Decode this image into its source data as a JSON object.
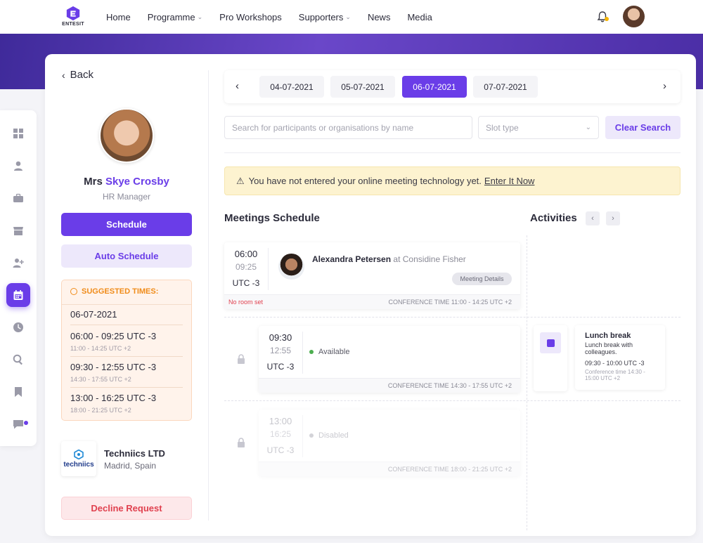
{
  "brand": {
    "logo_text": "ENTESIT",
    "accent": "#6a3de8"
  },
  "nav": {
    "items": [
      {
        "label": "Home",
        "dropdown": false
      },
      {
        "label": "Programme",
        "dropdown": true
      },
      {
        "label": "Pro Workshops",
        "dropdown": false
      },
      {
        "label": "Supporters",
        "dropdown": true
      },
      {
        "label": "News",
        "dropdown": false
      },
      {
        "label": "Media",
        "dropdown": false
      }
    ]
  },
  "sidebar_icons": [
    "grid-icon",
    "user-icon",
    "briefcase-icon",
    "store-icon",
    "add-user-icon",
    "calendar-icon",
    "clock-icon",
    "search-icon",
    "bookmark-icon",
    "chat-icon"
  ],
  "profile": {
    "back_label": "Back",
    "salutation": "Mrs",
    "name": "Skye Crosby",
    "role": "HR Manager",
    "schedule_label": "Schedule",
    "auto_schedule_label": "Auto Schedule",
    "suggested": {
      "heading": "SUGGESTED TIMES:",
      "date": "06-07-2021",
      "slots": [
        {
          "time": "06:00 - 09:25 UTC -3",
          "conf": "11:00 - 14:25 UTC +2"
        },
        {
          "time": "09:30 - 12:55 UTC -3",
          "conf": "14:30 - 17:55 UTC +2"
        },
        {
          "time": "13:00 - 16:25 UTC -3",
          "conf": "18:00 - 21:25 UTC +2"
        }
      ]
    },
    "organisation": {
      "logo_text": "techniics",
      "name": "Techniics LTD",
      "location": "Madrid, Spain"
    },
    "decline_label": "Decline Request"
  },
  "dates": {
    "items": [
      "04-07-2021",
      "05-07-2021",
      "06-07-2021",
      "07-07-2021"
    ],
    "active": "06-07-2021"
  },
  "search": {
    "placeholder": "Search for participants or organisations by name",
    "slot_type_placeholder": "Slot type",
    "clear_label": "Clear Search"
  },
  "warning": {
    "text": "You have not entered your online meeting technology yet.",
    "link": "Enter It Now"
  },
  "meetings": {
    "heading": "Meetings Schedule",
    "slots": [
      {
        "start": "06:00",
        "end": "09:25",
        "tz": "UTC -3",
        "person": "Alexandra Petersen",
        "org_prefix": "at",
        "org": "Considine Fisher",
        "details_label": "Meeting Details",
        "room": "No room set",
        "conf": "CONFERENCE TIME 11:00 - 14:25 UTC +2"
      },
      {
        "start": "09:30",
        "end": "12:55",
        "tz": "UTC -3",
        "status": "Available",
        "conf": "CONFERENCE TIME 14:30 - 17:55 UTC +2"
      },
      {
        "start": "13:00",
        "end": "16:25",
        "tz": "UTC -3",
        "status": "Disabled",
        "conf": "CONFERENCE TIME 18:00 - 21:25 UTC +2"
      }
    ]
  },
  "activities": {
    "heading": "Activities",
    "items": [
      {
        "title": "Lunch break",
        "description": "Lunch break with colleagues.",
        "time": "09:30 - 10:00 UTC -3",
        "conf": "Conference time 14:30 - 15:00 UTC +2"
      }
    ]
  }
}
